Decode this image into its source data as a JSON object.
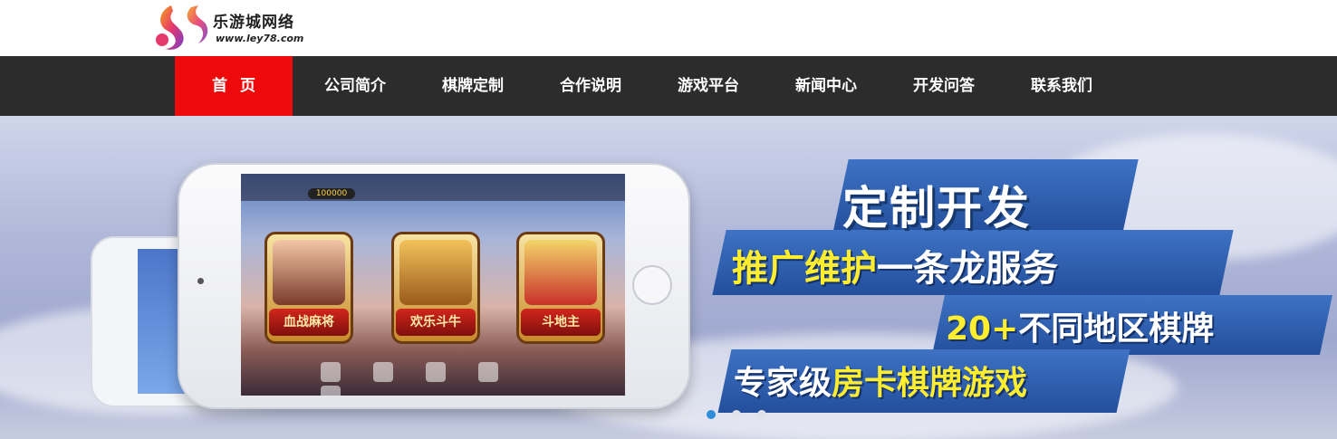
{
  "logo": {
    "name": "乐游城网络",
    "url": "www.ley78.com"
  },
  "nav": {
    "items": [
      {
        "label": "首页",
        "active": true
      },
      {
        "label": "公司简介"
      },
      {
        "label": "棋牌定制"
      },
      {
        "label": "合作说明"
      },
      {
        "label": "游戏平台"
      },
      {
        "label": "新闻中心"
      },
      {
        "label": "开发问答"
      },
      {
        "label": "联系我们"
      }
    ]
  },
  "banner": {
    "line1": "定制开发",
    "line2_yellow": "推广维护",
    "line2_white": "一条龙服务",
    "line3_yellow": "20+",
    "line3_white": "不同地区棋牌",
    "line4_white": "专家级",
    "line4_yellow": "房卡棋牌游戏",
    "phone": {
      "coins": "100000",
      "games": [
        "血战麻将",
        "欢乐斗牛",
        "斗地主"
      ]
    },
    "carousel": {
      "count": 4,
      "active_index": 1
    }
  },
  "colors": {
    "nav_bg": "#2c2c2c",
    "nav_active": "#ee0a0a",
    "accent_yellow": "#ffee2e",
    "panel_blue": "#2f5fb0"
  }
}
